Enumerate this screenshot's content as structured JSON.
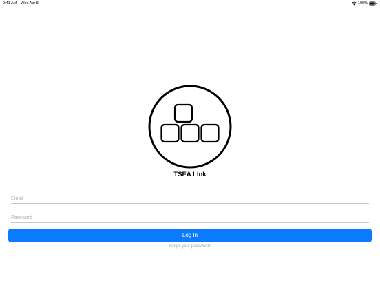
{
  "status_bar": {
    "time": "9:41 AM",
    "date": "Wed Apr 8",
    "battery": "100%",
    "wifi_icon": "wifi-icon",
    "battery_icon": "battery-icon"
  },
  "logo": {
    "icon": "stacked-blocks-logo-icon",
    "color": "#000000"
  },
  "app": {
    "title": "TSEA Link"
  },
  "form": {
    "email_placeholder": "Email",
    "email_value": "",
    "password_placeholder": "Password",
    "password_value": "",
    "login_label": "Log In",
    "forgot_label": "Forgot your password?"
  },
  "colors": {
    "accent": "#0a7bff",
    "background": "#ffffff",
    "placeholder": "#b3b3b8"
  }
}
